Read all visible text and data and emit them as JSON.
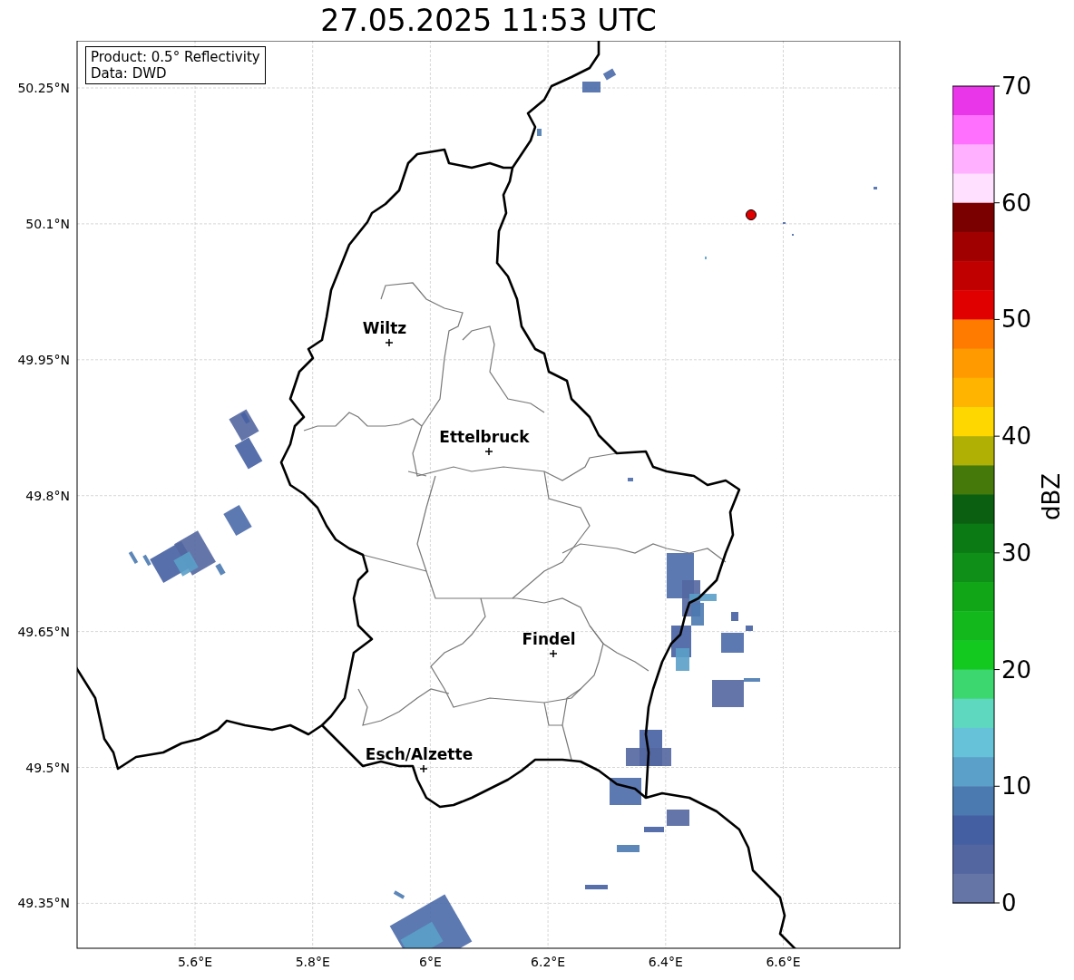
{
  "title": "27.05.2025 11:53 UTC",
  "info_box": [
    "Product: 0.5° Reflectivity",
    "Data: DWD"
  ],
  "map": {
    "lat_labels": [
      "50.25°N",
      "50.1°N",
      "49.95°N",
      "49.8°N",
      "49.65°N",
      "49.5°N",
      "49.35°N"
    ],
    "lon_labels": [
      "5.6°E",
      "5.8°E",
      "6°E",
      "6.2°E",
      "6.4°E",
      "6.6°E"
    ],
    "cities": [
      "Wiltz",
      "Ettelbruck",
      "Findel",
      "Esch/Alzette"
    ]
  },
  "colorbar": {
    "label": "dBZ",
    "ticks": [
      "70",
      "60",
      "50",
      "40",
      "30",
      "20",
      "10",
      "0"
    ],
    "steps": [
      {
        "color": "#e836e8"
      },
      {
        "color": "#ff70ff"
      },
      {
        "color": "#ffb0ff"
      },
      {
        "color": "#ffe0ff"
      },
      {
        "color": "#7a0000"
      },
      {
        "color": "#a00000"
      },
      {
        "color": "#c00000"
      },
      {
        "color": "#e00000"
      },
      {
        "color": "#ff7b00"
      },
      {
        "color": "#ff9a00"
      },
      {
        "color": "#ffb400"
      },
      {
        "color": "#ffd700"
      },
      {
        "color": "#b0b004"
      },
      {
        "color": "#457a0a"
      },
      {
        "color": "#0a6010"
      },
      {
        "color": "#0b7a14"
      },
      {
        "color": "#0f8f17"
      },
      {
        "color": "#10a618"
      },
      {
        "color": "#13b81c"
      },
      {
        "color": "#13c81e"
      },
      {
        "color": "#3dd770"
      },
      {
        "color": "#5fd8c0"
      },
      {
        "color": "#65c2d8"
      },
      {
        "color": "#5aa0c8"
      },
      {
        "color": "#4a7ab0"
      },
      {
        "color": "#4560a2"
      },
      {
        "color": "#5366a0"
      },
      {
        "color": "#6575a6"
      }
    ]
  }
}
